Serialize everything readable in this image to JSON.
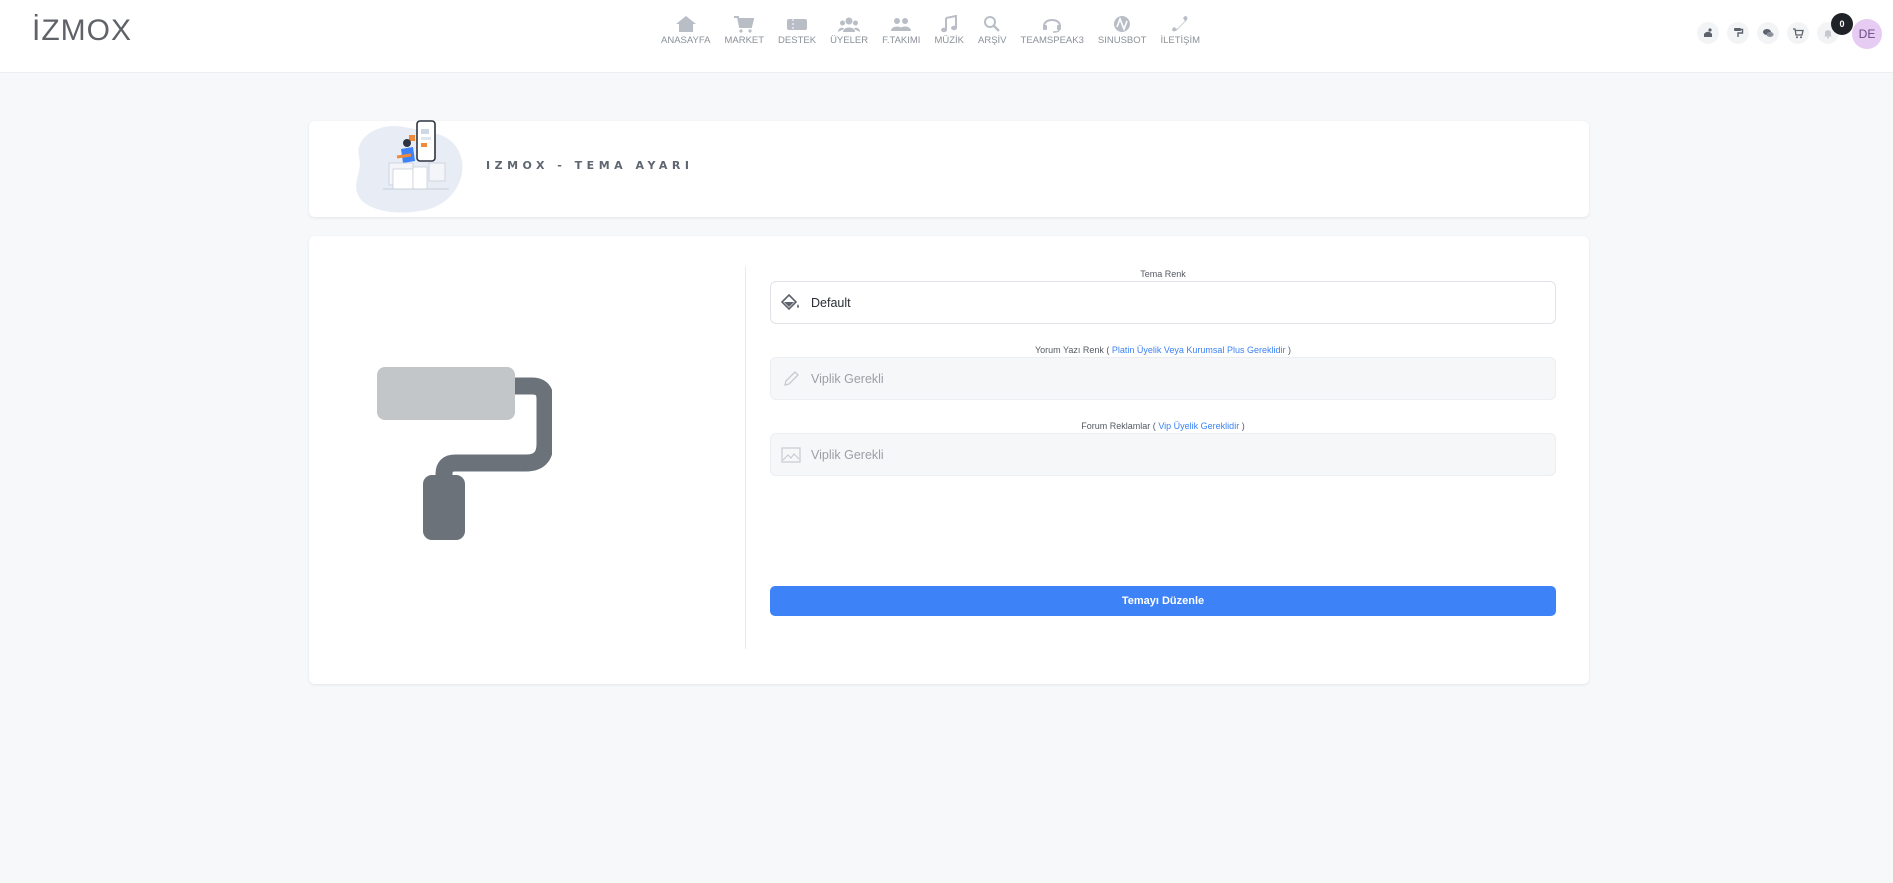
{
  "header": {
    "logo": "İZMOX",
    "nav": [
      {
        "label": "ANASAYFA",
        "icon": "home-icon"
      },
      {
        "label": "MARKET",
        "icon": "cart-icon"
      },
      {
        "label": "DESTEK",
        "icon": "ticket-icon"
      },
      {
        "label": "ÜYELER",
        "icon": "users-icon"
      },
      {
        "label": "F.TAKIMI",
        "icon": "team-icon"
      },
      {
        "label": "MÜZİK",
        "icon": "music-icon"
      },
      {
        "label": "ARŞİV",
        "icon": "search-icon"
      },
      {
        "label": "TEAMSPEAK3",
        "icon": "headset-icon"
      },
      {
        "label": "SINUSBOT",
        "icon": "sinusbot-icon"
      },
      {
        "label": "İLETİŞİM",
        "icon": "phone-icon"
      }
    ],
    "tools": [
      {
        "icon": "theme-icon"
      },
      {
        "icon": "paint-roller-icon"
      },
      {
        "icon": "chat-icon"
      },
      {
        "icon": "cart-icon"
      },
      {
        "icon": "bell-icon"
      }
    ],
    "notification_count": "0",
    "avatar": "DE"
  },
  "title_card": {
    "title": "IZMOX - TEMA AYARI"
  },
  "form": {
    "theme_color": {
      "label": "Tema Renk",
      "value": "Default"
    },
    "comment_color": {
      "label": "Yorum Yazı Renk (",
      "label_link": "Platin Üyelik Veya Kurumsal Plus Gereklidir",
      "label_end": ")",
      "value": "Viplik Gerekli"
    },
    "forum_ads": {
      "label": "Forum Reklamlar (",
      "label_link": "Vip Üyelik Gereklidir",
      "label_end": ")",
      "value": "Viplik Gerekli"
    },
    "submit_label": "Temayı Düzenle"
  },
  "colors": {
    "accent": "#3d82f6",
    "background": "#f7f8fa"
  }
}
